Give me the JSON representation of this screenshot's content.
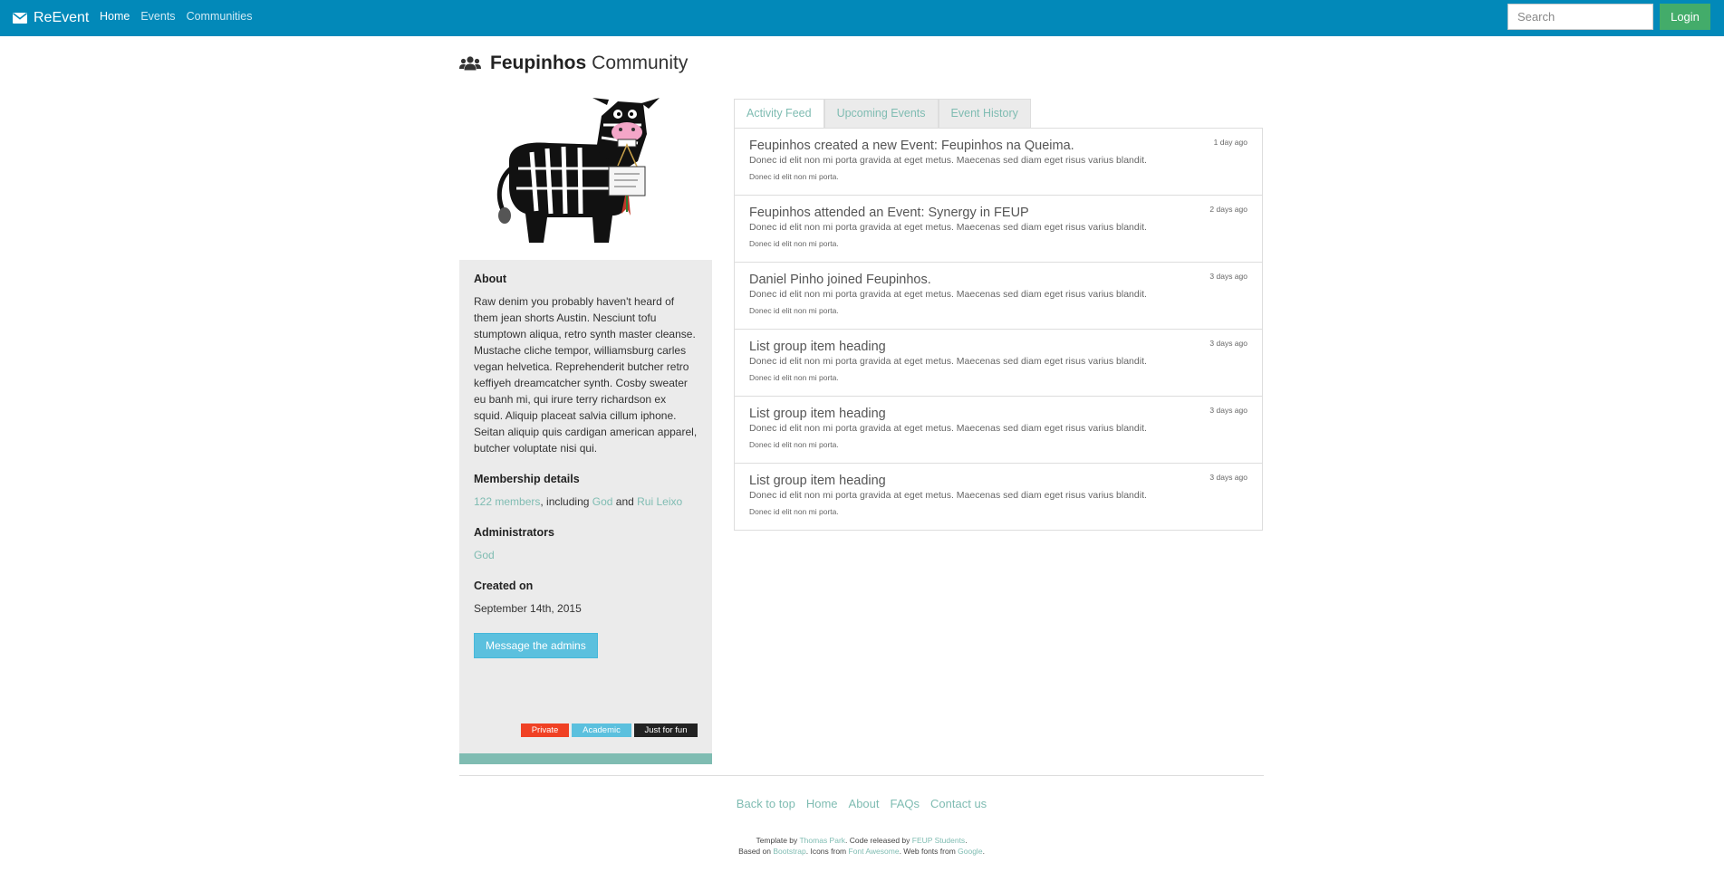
{
  "navbar": {
    "brand": "ReEvent",
    "links": [
      {
        "label": "Home",
        "active": true
      },
      {
        "label": "Events",
        "active": false
      },
      {
        "label": "Communities",
        "active": false
      }
    ],
    "search_placeholder": "Search",
    "login_label": "Login",
    "color": "#0289b9"
  },
  "page": {
    "title_name": "Feupinhos",
    "title_suffix": "Community"
  },
  "sidebar": {
    "about_heading": "About",
    "about_text": "Raw denim you probably haven't heard of them jean shorts Austin. Nesciunt tofu stumptown aliqua, retro synth master cleanse. Mustache cliche tempor, williamsburg carles vegan helvetica. Reprehenderit butcher retro keffiyeh dreamcatcher synth. Cosby sweater eu banh mi, qui irure terry richardson ex squid. Aliquip placeat salvia cillum iphone. Seitan aliquip quis cardigan american apparel, butcher voluptate nisi qui.",
    "membership_heading": "Membership details",
    "members_link": "122 members",
    "including_text": ", including ",
    "member1": "God",
    "and_text": " and ",
    "member2": "Rui Leixo",
    "admins_heading": "Administrators",
    "admin1": "God",
    "created_heading": "Created on",
    "created_date": "September 14th, 2015",
    "message_button": "Message the admins",
    "tags": [
      "Private",
      "Academic",
      "Just for fun"
    ]
  },
  "tabs": [
    "Activity Feed",
    "Upcoming Events",
    "Event History"
  ],
  "feed": [
    {
      "heading": "Feupinhos created a new Event: Feupinhos na Queima.",
      "text": "Donec id elit non mi porta gravida at eget metus. Maecenas sed diam eget risus varius blandit.",
      "small": "Donec id elit non mi porta.",
      "time": "1 day ago"
    },
    {
      "heading": "Feupinhos attended an Event: Synergy in FEUP",
      "text": "Donec id elit non mi porta gravida at eget metus. Maecenas sed diam eget risus varius blandit.",
      "small": "Donec id elit non mi porta.",
      "time": "2 days ago"
    },
    {
      "heading": "Daniel Pinho joined Feupinhos.",
      "text": "Donec id elit non mi porta gravida at eget metus. Maecenas sed diam eget risus varius blandit.",
      "small": "Donec id elit non mi porta.",
      "time": "3 days ago"
    },
    {
      "heading": "List group item heading",
      "text": "Donec id elit non mi porta gravida at eget metus. Maecenas sed diam eget risus varius blandit.",
      "small": "Donec id elit non mi porta.",
      "time": "3 days ago"
    },
    {
      "heading": "List group item heading",
      "text": "Donec id elit non mi porta gravida at eget metus. Maecenas sed diam eget risus varius blandit.",
      "small": "Donec id elit non mi porta.",
      "time": "3 days ago"
    },
    {
      "heading": "List group item heading",
      "text": "Donec id elit non mi porta gravida at eget metus. Maecenas sed diam eget risus varius blandit.",
      "small": "Donec id elit non mi porta.",
      "time": "3 days ago"
    }
  ],
  "footer": {
    "links": [
      "Back to top",
      "Home",
      "About",
      "FAQs",
      "Contact us"
    ],
    "credit1_prefix": "Template by ",
    "credit1_author": "Thomas Park",
    "credit1_mid": ". Code released by ",
    "credit1_team": "FEUP Students",
    "credit1_end": ".",
    "credit2_prefix": "Based on ",
    "credit2_bootstrap": "Bootstrap",
    "credit2_mid": ". Icons from ",
    "credit2_fa": "Font Awesome",
    "credit2_mid2": ". Web fonts from ",
    "credit2_google": "Google",
    "credit2_end": "."
  },
  "colors": {
    "accent_teal": "#7fbcb2",
    "login_green": "#43ac6a",
    "info_blue": "#5bc0de",
    "private_red": "#f04124"
  },
  "icons": {
    "brand": "envelope-icon",
    "title": "users-icon",
    "community_image": "zebra-donkey-mascot"
  }
}
